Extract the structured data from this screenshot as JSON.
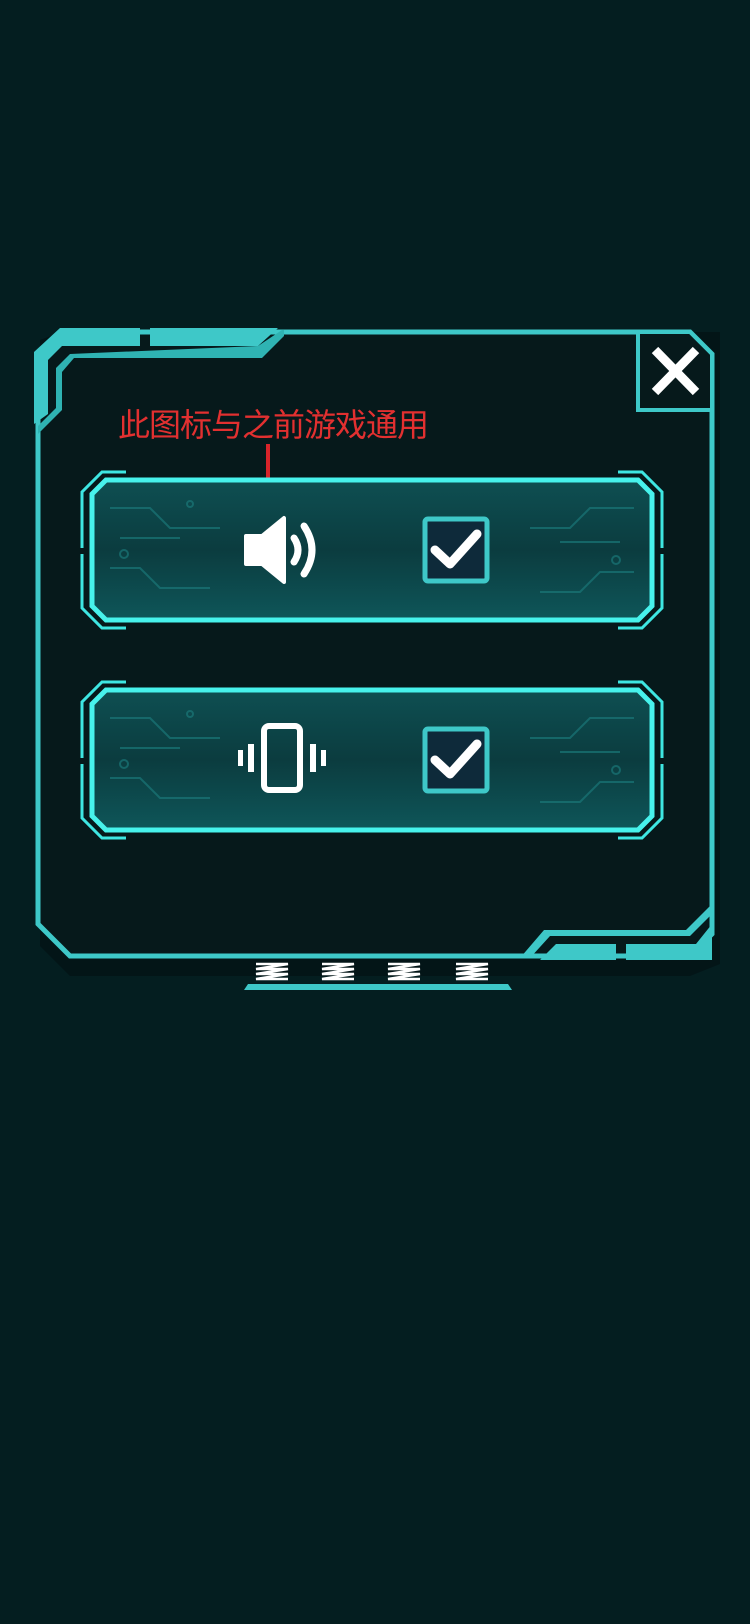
{
  "annotation": {
    "text": "此图标与之前游戏通用"
  },
  "settings": [
    {
      "icon": "speaker-icon",
      "checked": true
    },
    {
      "icon": "vibrate-phone-icon",
      "checked": true
    }
  ],
  "close_icon": "close-icon",
  "colors": {
    "background": "#041e20",
    "frame": "#3ec8c8",
    "frame_bright": "#6ff0ec",
    "panel": "#06191b",
    "row_fill": "#0e5a5c",
    "check_fill": "#0e2a3a",
    "annotation": "#e23030",
    "icon": "#ffffff"
  }
}
